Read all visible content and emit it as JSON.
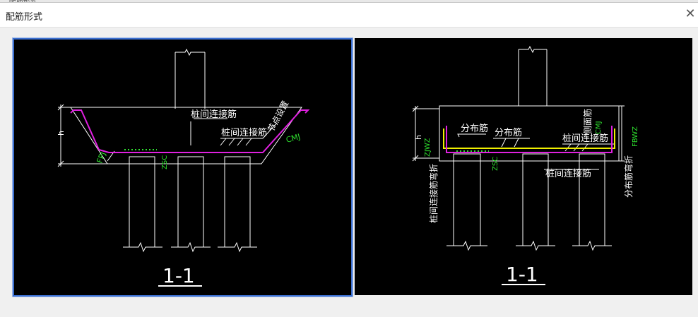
{
  "background_strip": "... 配筋形式 ...",
  "dialog": {
    "title": "配筋形式",
    "close_glyph": "✕"
  },
  "left_panel": {
    "section_label": "1-1",
    "labels": {
      "pile_connect_top": "桩间连接筋",
      "pile_connect_mid": "桩间连接筋",
      "node_setting": "节点设置",
      "h": "h",
      "fpj": "FPJ",
      "zsc": "ZSC",
      "cmj": "CMJ"
    }
  },
  "right_panel": {
    "section_label": "1-1",
    "labels": {
      "distribution_1": "分布筋",
      "distribution_2": "分布筋",
      "pile_connect_right": "桩间连接筋",
      "pile_connect_bottom": "桩间连接筋",
      "side_face": "侧面筋",
      "cmj": "CMJ",
      "h": "h",
      "zjwz": "ZJWZ",
      "zsc": "ZSC",
      "fbwz": "FBWZ",
      "pile_connect_bend": "桩间连接筋弯折",
      "distribution_bend": "分布筋弯折"
    }
  },
  "colors": {
    "magenta_rebar": "#e020e0",
    "yellow_rebar": "#f0f000",
    "green_text": "#2ee02e",
    "panel_bg": "#000000",
    "selection_border": "#3b6fd0"
  }
}
